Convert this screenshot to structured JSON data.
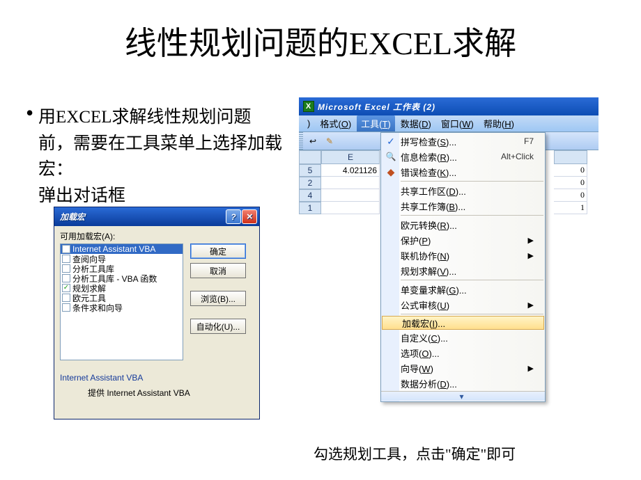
{
  "title": "线性规划问题的EXCEL求解",
  "bullet": {
    "line1": "用EXCEL求解线性规划问题前，需要在工具菜单上选择加载宏：",
    "line2": "弹出对话框"
  },
  "caption": "勾选规划工具，点击\"确定\"即可",
  "addin": {
    "title": "加载宏",
    "help_btn": "?",
    "close_btn": "×",
    "list_label": "可用加载宏(A):",
    "items": [
      {
        "label": "Internet Assistant VBA",
        "checked": false,
        "selected": true
      },
      {
        "label": "查阅向导",
        "checked": false,
        "selected": false
      },
      {
        "label": "分析工具库",
        "checked": false,
        "selected": false
      },
      {
        "label": "分析工具库 - VBA 函数",
        "checked": false,
        "selected": false
      },
      {
        "label": "规划求解",
        "checked": true,
        "selected": false
      },
      {
        "label": "欧元工具",
        "checked": false,
        "selected": false
      },
      {
        "label": "条件求和向导",
        "checked": false,
        "selected": false
      }
    ],
    "btn_ok": "确定",
    "btn_cancel": "取消",
    "btn_browse": "浏览(B)...",
    "btn_auto": "自动化(U)...",
    "desc_title": "Internet Assistant VBA",
    "desc_body": "提供 Internet Assistant VBA"
  },
  "excel": {
    "title": "Microsoft Excel 工作表 (2)",
    "menubar": [
      {
        "full": ")"
      },
      {
        "label": "格式",
        "key": "O"
      },
      {
        "label": "工具",
        "key": "T",
        "open": true
      },
      {
        "label": "数据",
        "key": "D"
      },
      {
        "label": "窗口",
        "key": "W"
      },
      {
        "label": "帮助",
        "key": "H"
      }
    ],
    "columns": {
      "E": "E"
    },
    "rows": [
      {
        "h": "5",
        "E": "4.021126"
      },
      {
        "h": "2",
        "E": ""
      },
      {
        "h": "4",
        "E": ""
      },
      {
        "h": "1",
        "E": ""
      }
    ],
    "gcol": [
      "0",
      "0",
      "0",
      "1"
    ]
  },
  "tools_menu": [
    {
      "icon": "spell",
      "label_pre": "拼写检查(",
      "u": "S",
      "label_post": ")...",
      "shortcut": "F7"
    },
    {
      "icon": "research",
      "label_pre": "信息检索(",
      "u": "R",
      "label_post": ")...",
      "shortcut": "Alt+Click"
    },
    {
      "icon": "error",
      "label_pre": "错误检查(",
      "u": "K",
      "label_post": ")..."
    },
    {
      "sep": true
    },
    {
      "label_pre": "共享工作区(",
      "u": "D",
      "label_post": ")..."
    },
    {
      "label_pre": "共享工作簿(",
      "u": "B",
      "label_post": ")..."
    },
    {
      "sep": true
    },
    {
      "label_pre": "欧元转换(",
      "u": "R",
      "label_post": ")..."
    },
    {
      "label_pre": "保护(",
      "u": "P",
      "label_post": ")",
      "submenu": true
    },
    {
      "label_pre": "联机协作(",
      "u": "N",
      "label_post": ")",
      "submenu": true
    },
    {
      "label_pre": "规划求解(",
      "u": "V",
      "label_post": ")..."
    },
    {
      "sep": true
    },
    {
      "label_pre": "单变量求解(",
      "u": "G",
      "label_post": ")..."
    },
    {
      "label_pre": "公式审核(",
      "u": "U",
      "label_post": ")",
      "submenu": true
    },
    {
      "sep": true
    },
    {
      "label_pre": "加载宏(",
      "u": "I",
      "label_post": ")...",
      "highlight": true
    },
    {
      "label_pre": "自定义(",
      "u": "C",
      "label_post": ")..."
    },
    {
      "label_pre": "选项(",
      "u": "O",
      "label_post": ")..."
    },
    {
      "label_pre": "向导(",
      "u": "W",
      "label_post": ")",
      "submenu": true
    },
    {
      "label_pre": "数据分析(",
      "u": "D",
      "label_post": ")..."
    }
  ],
  "menu_expand": "⌄"
}
